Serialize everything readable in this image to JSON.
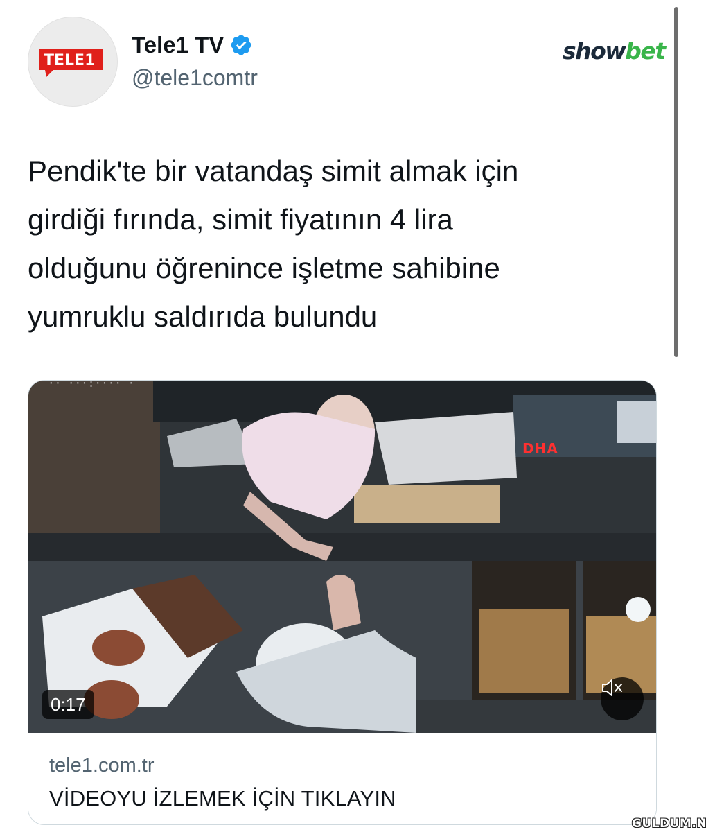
{
  "tweet": {
    "author": {
      "name": "Tele1 TV",
      "handle": "@tele1comtr",
      "avatar_text": "TELE1",
      "verified": true
    },
    "text": "Pendik'te bir vatandaş simit almak için\ngirdiği fırında, simit fiyatının 4 lira\nolduğunu öğrenince işletme sahibine\nyumruklu saldırıda bulundu"
  },
  "watermark": {
    "part_a": "show",
    "part_b": "bet"
  },
  "card": {
    "video": {
      "duration": "0:17",
      "channel_logo": "DHA",
      "mute_icon": "speaker-muted-icon"
    },
    "domain": "tele1.com.tr",
    "title": "VİDEOYU İZLEMEK İÇİN TIKLAYIN"
  },
  "site_watermark": "GULDUM.NET",
  "colors": {
    "verified": "#1d9bf0",
    "text_primary": "#0f1419",
    "text_secondary": "#536471",
    "card_border": "#cfd9de",
    "avatar_red": "#e0201b"
  }
}
